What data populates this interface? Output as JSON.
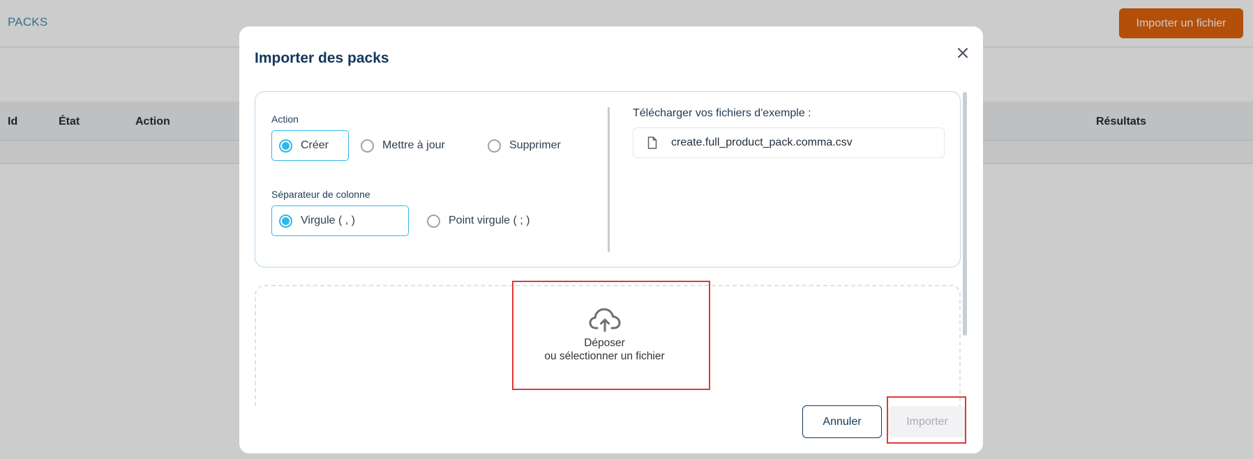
{
  "page": {
    "title": "PACKS",
    "import_file_button": "Importer un fichier",
    "table_headers": [
      "Id",
      "État",
      "Action",
      "Résultats"
    ]
  },
  "modal": {
    "title": "Importer des packs",
    "close_icon": "close-icon",
    "action_group": {
      "label": "Action",
      "options": [
        "Créer",
        "Mettre à jour",
        "Supprimer"
      ],
      "selected": "Créer"
    },
    "separator_group": {
      "label": "Séparateur de colonne",
      "options": [
        "Virgule ( , )",
        "Point virgule ( ; )"
      ],
      "selected": "Virgule ( , )"
    },
    "samples": {
      "label": "Télécharger vos fichiers d'exemple :",
      "files": [
        "create.full_product_pack.comma.csv"
      ]
    },
    "dropzone": {
      "line1": "Déposer",
      "line2": "ou sélectionner un fichier",
      "icon": "cloud-upload-icon"
    },
    "buttons": {
      "cancel": "Annuler",
      "import": "Importer"
    }
  },
  "colors": {
    "accent": "#2fb8e6",
    "brand_orange": "#e0630c",
    "title_navy": "#12365c",
    "highlight_red": "#e0373a"
  }
}
